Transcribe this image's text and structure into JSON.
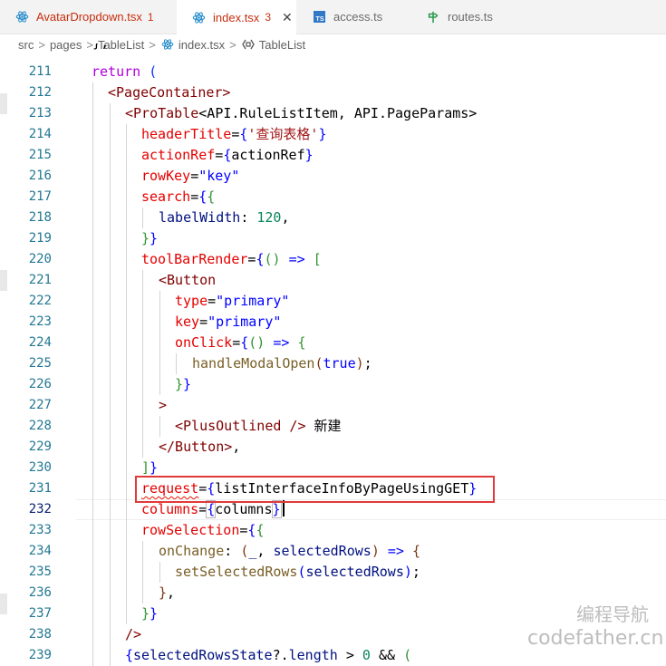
{
  "tabs": [
    {
      "label": "AvatarDropdown.tsx",
      "badge": "1",
      "icon": "react-icon"
    },
    {
      "label": "index.tsx",
      "badge": "3",
      "icon": "react-icon",
      "active": true,
      "close": "✕"
    },
    {
      "label": "access.ts",
      "badge": "",
      "icon": "ts-icon",
      "icon_text": "TS"
    },
    {
      "label": "routes.ts",
      "badge": "",
      "icon": "route-icon"
    }
  ],
  "breadcrumb": {
    "parts": [
      "src",
      "pages",
      "TableList",
      "index.tsx",
      "TableList"
    ],
    "separator": ">"
  },
  "editor": {
    "top_partial": "  };",
    "line_numbers": [
      "211",
      "212",
      "213",
      "214",
      "215",
      "216",
      "217",
      "218",
      "219",
      "220",
      "221",
      "222",
      "223",
      "224",
      "225",
      "226",
      "227",
      "228",
      "229",
      "230",
      "231",
      "232",
      "233",
      "234",
      "235",
      "236",
      "237",
      "238",
      "239"
    ],
    "current_line": "232"
  },
  "watermark": {
    "line1": "编程导航",
    "line2": "codefather.cn"
  },
  "colors": {
    "accent_tab": "#ffffff",
    "line_number": "#237893",
    "highlight_box": "#e03a3a"
  }
}
